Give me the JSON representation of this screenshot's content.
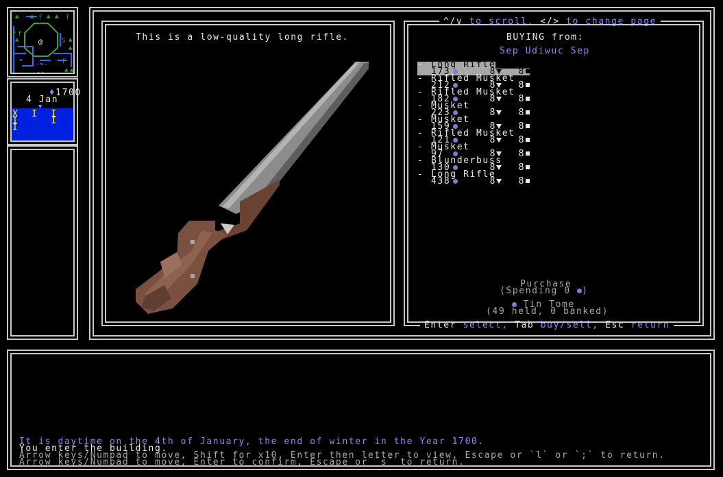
{
  "status": {
    "money_icon": "diamond-icon",
    "money": "1700",
    "date": "4 Jan",
    "date_marker_icon": "down-triangle-icon",
    "calendar_rows": [
      "X  I  I",
      "I     I",
      "I"
    ]
  },
  "viewer": {
    "description": "This is a low-quality long rifle."
  },
  "shop": {
    "hint_scroll": "^/v to scroll, </> to change page",
    "hint_scroll_parts": [
      "^/v",
      " to scroll, ",
      "</>",
      " to change page"
    ],
    "buying_label": "BUYING from:",
    "vendor": "Sep Udiwuc Sep",
    "items": [
      {
        "name": "Long Rifle",
        "price": "173",
        "qty": "8",
        "stock": "8",
        "selected": true
      },
      {
        "name": "Rifled Musket",
        "price": "212",
        "qty": "8",
        "stock": "8"
      },
      {
        "name": "Rifled Musket",
        "price": "182",
        "qty": "8",
        "stock": "8"
      },
      {
        "name": "Musket",
        "price": "223",
        "qty": "8",
        "stock": "8"
      },
      {
        "name": "Musket",
        "price": "159",
        "qty": "8",
        "stock": "8"
      },
      {
        "name": "Rifled Musket",
        "price": "121",
        "qty": "8",
        "stock": "8"
      },
      {
        "name": "Musket",
        "price": "97",
        "qty": "8",
        "stock": "8"
      },
      {
        "name": "Blunderbuss",
        "price": "130",
        "qty": "8",
        "stock": "8"
      },
      {
        "name": "Long Rifle",
        "price": "438",
        "qty": "8",
        "stock": "8"
      }
    ],
    "purchase_label": "Purchase",
    "spending_prefix": "(Spending 0",
    "spending_suffix": ")",
    "currency_name": "Tin Tome",
    "currency_status": "(49 held, 0 banked)",
    "footer": {
      "enter_key": "Enter",
      "select": "select,",
      "tab_key": "Tab",
      "buysell": "buy/sell,",
      "esc_key": "Esc",
      "return": "return"
    }
  },
  "log": {
    "lines": [
      "It is daytime on the 4th of January, the end of winter in the Year 1700.",
      "You enter the building.",
      "Arrow keys/Numpad to move, Shift for x10, Enter then letter to view, Escape or `l` or `;` to return.",
      "Arrow keys/Numpad to move, Enter to confirm, Escape or `s` to return."
    ]
  },
  "colors": {
    "frame": "#c8c8c8",
    "accent_blue": "#8a8aff",
    "calendar_bg": "#0020e0",
    "calendar_text": "#ffff40",
    "rifle_stock": "#7a5040",
    "rifle_barrel": "#808080"
  }
}
